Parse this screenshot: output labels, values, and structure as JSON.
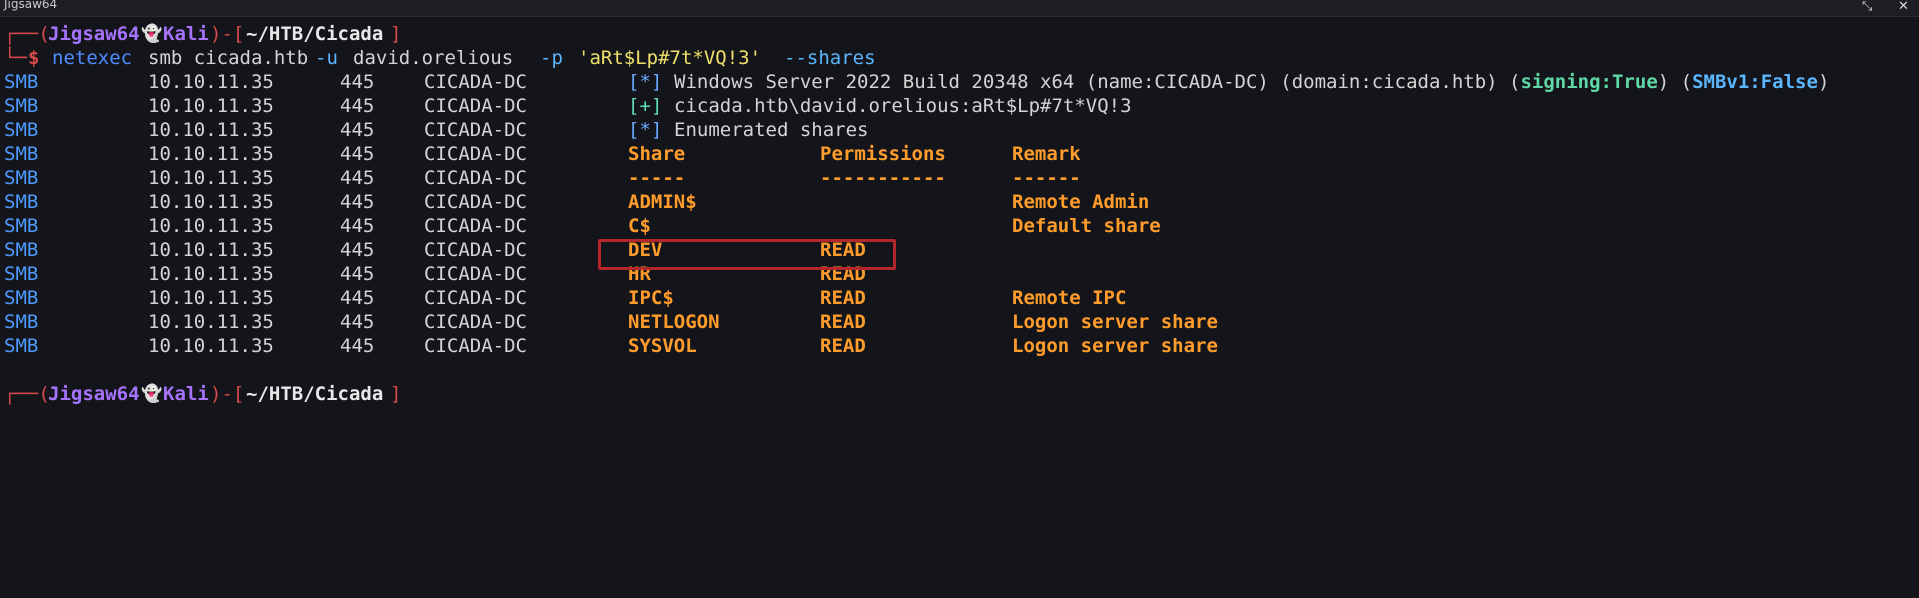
{
  "window": {
    "title": "Jigsaw64",
    "minimize_icon": "restore-icon",
    "close_icon": "close-icon"
  },
  "prompt": {
    "top_left": "┌──(",
    "user": "Jigsaw64",
    "ghost": "👻",
    "host": "Kali",
    "mid": ")-[",
    "path": "~/HTB/Cicada",
    "end": "]",
    "bottom_left": "└─",
    "dollar": "$"
  },
  "command": {
    "bin": "netexec",
    "args1": "smb cicada.htb",
    "flag_u": "-u",
    "user_arg": "david.orelious",
    "flag_p": "-p",
    "pass_arg": "'aRt$Lp#7t*VQ!3'",
    "flag_shares": "--shares"
  },
  "output": {
    "proto": "SMB",
    "ip": "10.10.11.35",
    "port": "445",
    "host": "CICADA-DC",
    "info_line": {
      "tag": "[*]",
      "text": "Windows Server 2022 Build 20348 x64 (name:CICADA-DC) (domain:cicada.htb) (",
      "signing": "signing:True",
      "between": ") (",
      "smbv1": "SMBv1:False",
      "close": ")"
    },
    "auth_line": {
      "tag": "[+]",
      "text": "cicada.htb\\david.orelious:aRt$Lp#7t*VQ!3"
    },
    "enum_line": {
      "tag": "[*]",
      "text": "Enumerated shares"
    },
    "headers": [
      "Share",
      "Permissions",
      "Remark"
    ],
    "dashes": [
      "-----",
      "-----------",
      "------"
    ],
    "shares": [
      {
        "share": "ADMIN$",
        "perm": "",
        "remark": "Remote Admin"
      },
      {
        "share": "C$",
        "perm": "",
        "remark": "Default share"
      },
      {
        "share": "DEV",
        "perm": "READ",
        "remark": ""
      },
      {
        "share": "HR",
        "perm": "READ",
        "remark": ""
      },
      {
        "share": "IPC$",
        "perm": "READ",
        "remark": "Remote IPC"
      },
      {
        "share": "NETLOGON",
        "perm": "READ",
        "remark": "Logon server share"
      },
      {
        "share": "SYSVOL",
        "perm": "READ",
        "remark": "Logon server share"
      }
    ]
  },
  "colors": {
    "background": "#14151a",
    "prompt_red": "#d84a4a",
    "user_purple": "#a673ff",
    "smb_blue": "#4c9cff",
    "share_orange": "#ff9c2b",
    "highlight": "#b3262b"
  }
}
